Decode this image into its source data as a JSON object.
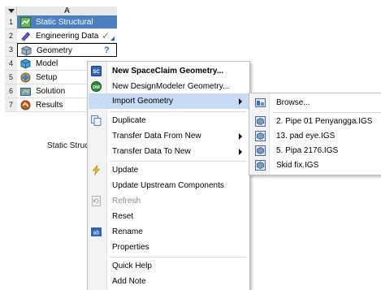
{
  "system": {
    "column_header": "A",
    "rows": [
      {
        "num": "1",
        "label": "Static Structural"
      },
      {
        "num": "2",
        "label": "Engineering Data"
      },
      {
        "num": "3",
        "label": "Geometry"
      },
      {
        "num": "4",
        "label": "Model"
      },
      {
        "num": "5",
        "label": "Setup"
      },
      {
        "num": "6",
        "label": "Solution"
      },
      {
        "num": "7",
        "label": "Results"
      }
    ],
    "caption": "Static Structu",
    "status": {
      "check": "✓",
      "question": "?"
    }
  },
  "context_menu": {
    "items": {
      "new_spaceclaim": "New SpaceClaim Geometry...",
      "new_designmodeler": "New DesignModeler Geometry...",
      "import_geometry": "Import Geometry",
      "duplicate": "Duplicate",
      "transfer_from_new": "Transfer Data From New",
      "transfer_to_new": "Transfer Data To New",
      "update": "Update",
      "update_upstream": "Update Upstream Components",
      "refresh": "Refresh",
      "reset": "Reset",
      "rename": "Rename",
      "properties": "Properties",
      "quick_help": "Quick Help",
      "add_note": "Add Note"
    },
    "icon_text": {
      "spaceclaim": "SC",
      "designmodeler": "DM",
      "rename": "ab"
    }
  },
  "import_submenu": {
    "browse": "Browse...",
    "recent_files": [
      "2. Pipe 01 Penyangga.IGS",
      "13. pad eye.IGS",
      "5. Pipa 2176.IGS",
      "Skid fix.IGS"
    ]
  },
  "colors": {
    "title_row": "#4a7fc0",
    "menu_hover": "#c7dcf4",
    "check": "#4a9a2a",
    "question": "#2c6fd0"
  }
}
